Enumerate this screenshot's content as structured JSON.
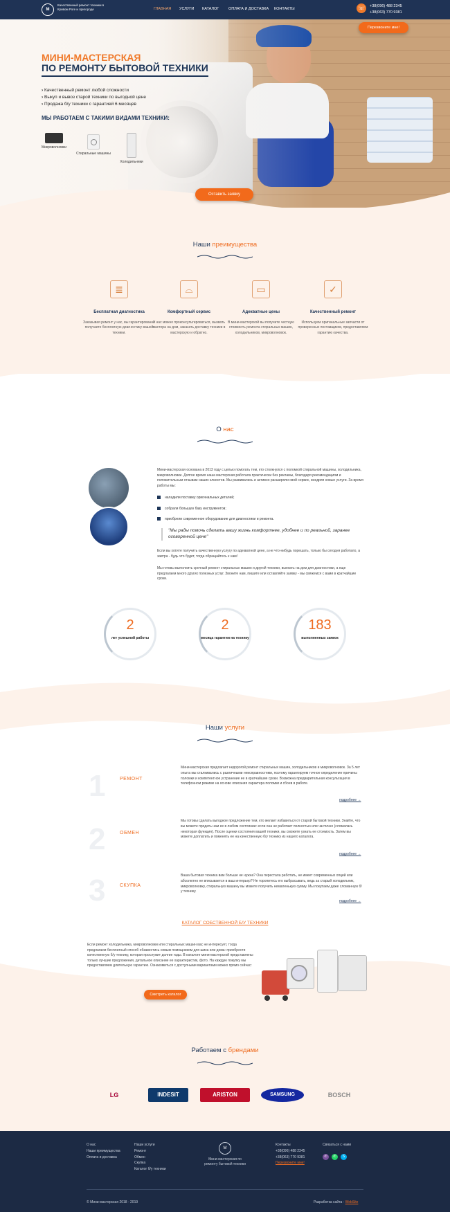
{
  "header": {
    "logo_text": "Качественный ремонт техники в Кривом Роге и пригороде",
    "logo_mark": "М",
    "nav": [
      "ГЛАВНАЯ",
      "УСЛУГИ",
      "КАТАЛОГ",
      "ОПЛАТА И ДОСТАВКА",
      "КОНТАКТЫ"
    ],
    "phones": [
      "+38(096) 488 2345",
      "+38(063) 770 9381"
    ],
    "callback_button": "Перезвоните мне!"
  },
  "hero": {
    "title_line1": "МИНИ-МАСТЕРСКАЯ",
    "title_line2": "ПО РЕМОНТУ БЫТОВОЙ ТЕХНИКИ",
    "bullets": [
      "Качественный ремонт любой сложности",
      "Выкуп и вывоз старой техники по выгодной цене",
      "Продажа б/у техники с гарантией 6 месяцев"
    ],
    "appliances_title": "МЫ РАБОТАЕМ С ТАКИМИ ВИДАМИ ТЕХНИКИ:",
    "appliances": [
      "Микроволновки",
      "Стиральные машины",
      "Холодильники"
    ],
    "cta": "Оставить заявку"
  },
  "advantages": {
    "title_prefix": "Наши ",
    "title_accent": "преимущества",
    "items": [
      {
        "title": "Бесплатная диагностика",
        "text": "Заказывая ремонт у нас, вы гарантированно получаете бесплатную диагностику вашей техники."
      },
      {
        "title": "Комфортный сервис",
        "text": "У нас можно проконсультироваться, вызвать мастера на дом, заказать доставку техники в мастерскую и обратно."
      },
      {
        "title": "Адекватные цены",
        "text": "В мини-мастерской вы получите честную стоимость ремонта стиральных машин, холодильников, микроволновок."
      },
      {
        "title": "Качественный ремонт",
        "text": "Используем оригинальные запчасти от проверенных поставщиков, предоставляем гарантию качества."
      }
    ]
  },
  "about": {
    "title_prefix": "О ",
    "title_accent": "нас",
    "p1": "Мини-мастерская основана в 2013 году с целью помогать тем, кто столкнулся с поломкой стиральной машины, холодильника, микроволновки. Долгое время наша мастерская работала практически без рекламы, благодаря рекомендациям и положительным отзывам наших клиентов. Мы развивались и активно расширяли свой сервис, внедряя новые услуги. За время работы мы:",
    "bullets": [
      "наладили поставку оригинальных деталей;",
      "собрали большую базу инструментов;",
      "приобрели современное оборудование для диагностики и ремонта."
    ],
    "quote": "\"Мы рады помочь сделать вашу жизнь комфортнее, удобнее и по реальной, заранее оговоренной цене\"",
    "p2": "Если вы хотите получить качественную услугу по адекватной цене, а не что-нибудь порешать, только бы сегодня работало, а завтра - будь что будет, тогда обращайтесь к нам!",
    "p3": "Мы готовы выполнить срочный ремонт стиральных машин и другой техники, выехать на дом для диагностики, а еще предлагаем много других полезных услуг. Звоните нам, пишите или оставляйте заявку - мы свяжемся с вами в кратчайшие сроки."
  },
  "stats": [
    {
      "value": "2",
      "label": "лет успешной работы"
    },
    {
      "value": "2",
      "label": "месяца гарантии на технику"
    },
    {
      "value": "183",
      "label": "выполненных заявок"
    }
  ],
  "services": {
    "title_prefix": "Наши ",
    "title_accent": "услуги",
    "more_label": "подробнее →",
    "items": [
      {
        "num": "1",
        "name": "РЕМОНТ",
        "text": "Мини-мастерская предлагает недорогой ремонт стиральных машин, холодильников и микроволновок. За 5 лет опыта мы сталкивались с различными неисправностями, поэтому гарантируем точное определение причины поломки и компетентное устранение ее в кратчайшие сроки. Возможна предварительная консультация в телефонном режиме на основе описания характера поломки и сбоев в работе."
      },
      {
        "num": "2",
        "name": "ОБМЕН",
        "text": "Мы готовы сделать выгодное предложение тем, кто желает избавиться от старой бытовой техники. Знайте, что вы можете продать нам ее в любом состоянии: если она не работает полностью или частично (сломалась некоторая функция). После оценки состояния вашей техники, вы сможете узнать ее стоимость. Затем вы можете доплатить и поменять ее на качественную б/у технику из нашего каталога."
      },
      {
        "num": "3",
        "name": "СКУПКА",
        "text": "Ваша бытовая техника вам больше не нужна? Она перестала работать, не имеет современных опций или абсолютно не вписывается в ваш интерьер? Не торопитесь его выбрасывать, ведь за старый холодильник, микроволновку, стиральную машину вы можете получить немаленькую сумму. Мы покупаем даже сломанную б/у технику."
      }
    ]
  },
  "catalog": {
    "title": "КАТАЛОГ СОБСТВЕННОЙ Б/У ТЕХНИКИ",
    "text": "Если ремонт холодильника, микроволновки или стиральных машин вас не интересует, тогда предлагаем бесплатный способ обзавестись новым помощником для шика или дома: приобрести качественную б/у технику, которая прослужит долгие годы. В каталоге мини-мастерской представлены только лучшие предложения, детальное описание ее характеристик, фото. На каждую покупку мы предоставляем длительную гарантию. Ознакомиться с доступными вариантами можно прямо сейчас:",
    "button": "Смотреть каталог"
  },
  "brands": {
    "title_prefix": "Работаем с ",
    "title_accent": "брендами",
    "items": [
      "LG",
      "INDESIT",
      "ARISTON",
      "SAMSUNG",
      "BOSCH"
    ]
  },
  "footer": {
    "col1": [
      "О нас",
      "Наши преимущества",
      "Оплата и доставка"
    ],
    "col2": [
      "Наши услуги",
      "Ремонт",
      "Обмен",
      "Скупка",
      "Каталог б/у техники"
    ],
    "center_text": "Мини-мастерская по ремонту бытовой техники",
    "contacts_title": "Контакты",
    "phones": [
      "+38(096) 488 2345",
      "+38(063) 770 9381"
    ],
    "callback": "Перезвоните мне!",
    "contact_us": "Связаться с нами",
    "copyright": "© Мини-мастерская 2018 - 2019",
    "dev_label": "Разработка сайта - ",
    "dev_name": "WebSite"
  }
}
